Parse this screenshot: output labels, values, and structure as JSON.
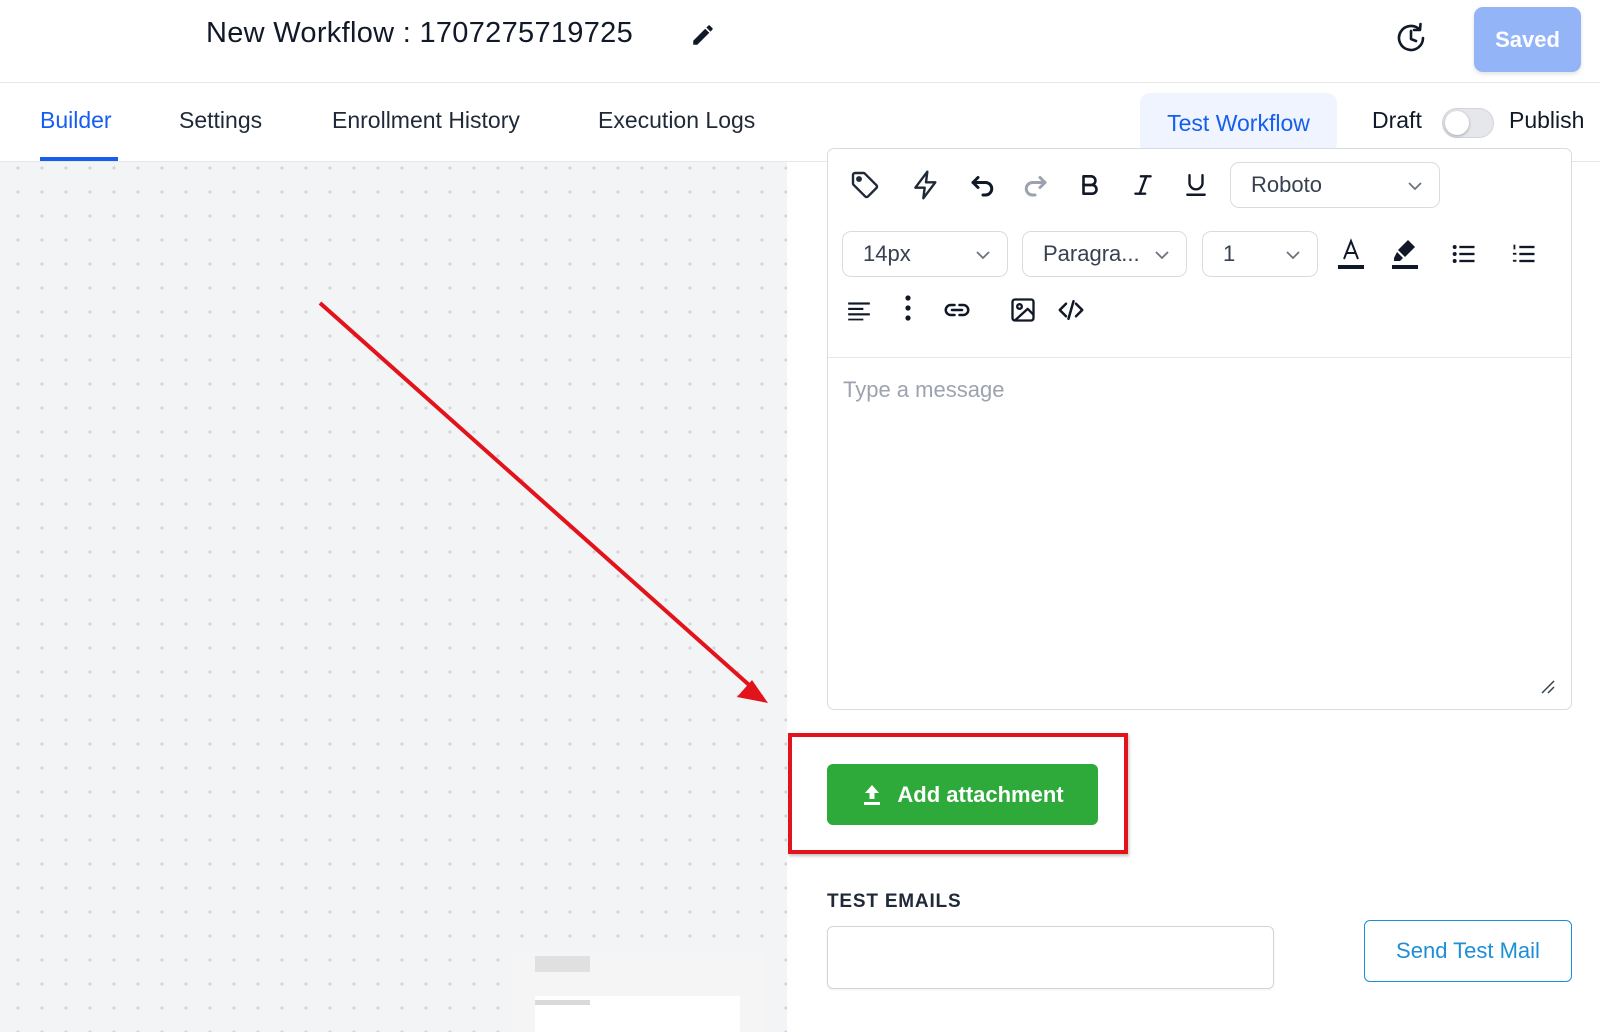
{
  "header": {
    "title": "New Workflow : 1707275719725",
    "saved_label": "Saved"
  },
  "tabs": {
    "items": [
      {
        "label": "Builder",
        "active": true
      },
      {
        "label": "Settings",
        "active": false
      },
      {
        "label": "Enrollment History",
        "active": false
      },
      {
        "label": "Execution Logs",
        "active": false
      }
    ],
    "test_workflow_label": "Test Workflow",
    "draft_label": "Draft",
    "publish_label": "Publish",
    "publish_toggle_on": false
  },
  "editor": {
    "font_family": "Roboto",
    "font_size": "14px",
    "block_type": "Paragra...",
    "line_height": "1",
    "message_placeholder": "Type a message",
    "toolbar_icons": [
      "tag-icon",
      "lightning-icon",
      "undo-icon",
      "redo-icon",
      "bold-icon",
      "italic-icon",
      "underline-icon",
      "text-color-icon",
      "highlight-icon",
      "bullet-list-icon",
      "numbered-list-icon",
      "align-left-icon",
      "more-vertical-icon",
      "link-icon",
      "image-icon",
      "code-icon"
    ]
  },
  "attachment": {
    "button_label": "Add attachment"
  },
  "test_emails": {
    "label": "TEST EMAILS",
    "value": "",
    "send_label": "Send Test Mail"
  },
  "colors": {
    "primary": "#155eef",
    "saved_button": "#93b4f7",
    "attach_green": "#2eaa3b",
    "annotation_red": "#e3131b",
    "send_button": "#1d8fd6"
  }
}
